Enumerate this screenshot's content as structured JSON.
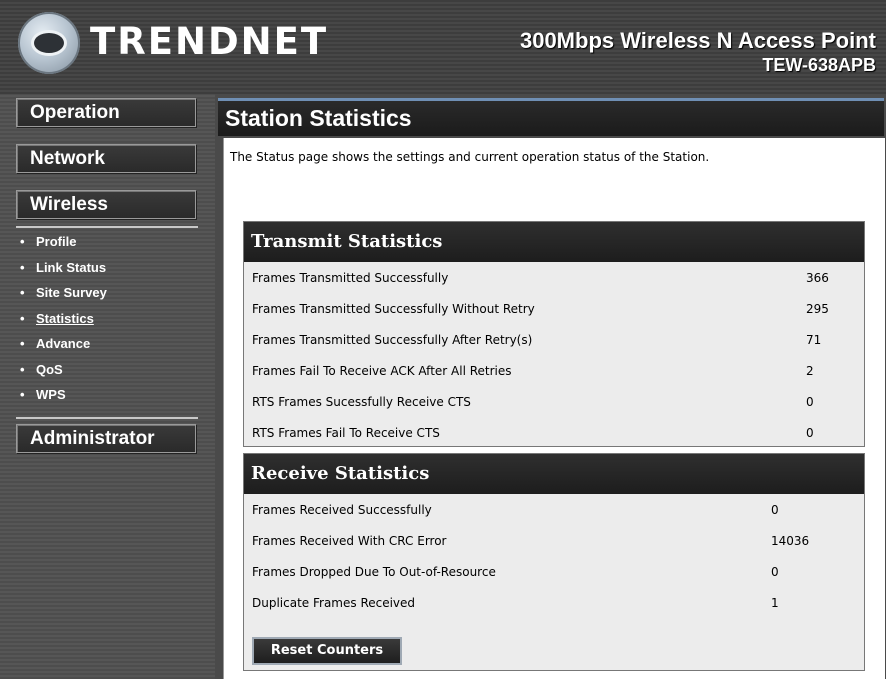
{
  "header": {
    "logo_text": "TRENDNET",
    "product_name": "300Mbps Wireless N Access Point",
    "product_model": "TEW-638APB"
  },
  "sidebar": {
    "operation": "Operation",
    "network": "Network",
    "wireless": "Wireless",
    "administrator": "Administrator",
    "wireless_items": [
      {
        "label": "Profile"
      },
      {
        "label": "Link Status"
      },
      {
        "label": "Site Survey"
      },
      {
        "label": "Statistics"
      },
      {
        "label": "Advance"
      },
      {
        "label": "QoS"
      },
      {
        "label": "WPS"
      }
    ]
  },
  "main": {
    "title": "Station Statistics",
    "intro": "The Status page shows the settings and current operation status of the Station.",
    "transmit": {
      "title": "Transmit Statistics",
      "rows": [
        {
          "label": "Frames Transmitted Successfully",
          "value": "366"
        },
        {
          "label": "Frames Transmitted Successfully Without Retry",
          "value": "295"
        },
        {
          "label": "Frames Transmitted Successfully After Retry(s)",
          "value": "71"
        },
        {
          "label": "Frames Fail To Receive ACK After All Retries",
          "value": "2"
        },
        {
          "label": "RTS Frames Sucessfully Receive CTS",
          "value": "0"
        },
        {
          "label": "RTS Frames Fail To Receive CTS",
          "value": "0"
        }
      ]
    },
    "receive": {
      "title": "Receive Statistics",
      "rows": [
        {
          "label": "Frames Received Successfully",
          "value": "0"
        },
        {
          "label": "Frames Received With CRC Error",
          "value": "14036"
        },
        {
          "label": "Frames Dropped Due To Out-of-Resource",
          "value": "0"
        },
        {
          "label": "Duplicate Frames Received",
          "value": "1"
        }
      ]
    },
    "reset_label": "Reset Counters"
  },
  "colors": {
    "accent_blue": "#6f8fb4",
    "panel_bg": "#ececec",
    "header_dark": "#1d1d1d"
  }
}
